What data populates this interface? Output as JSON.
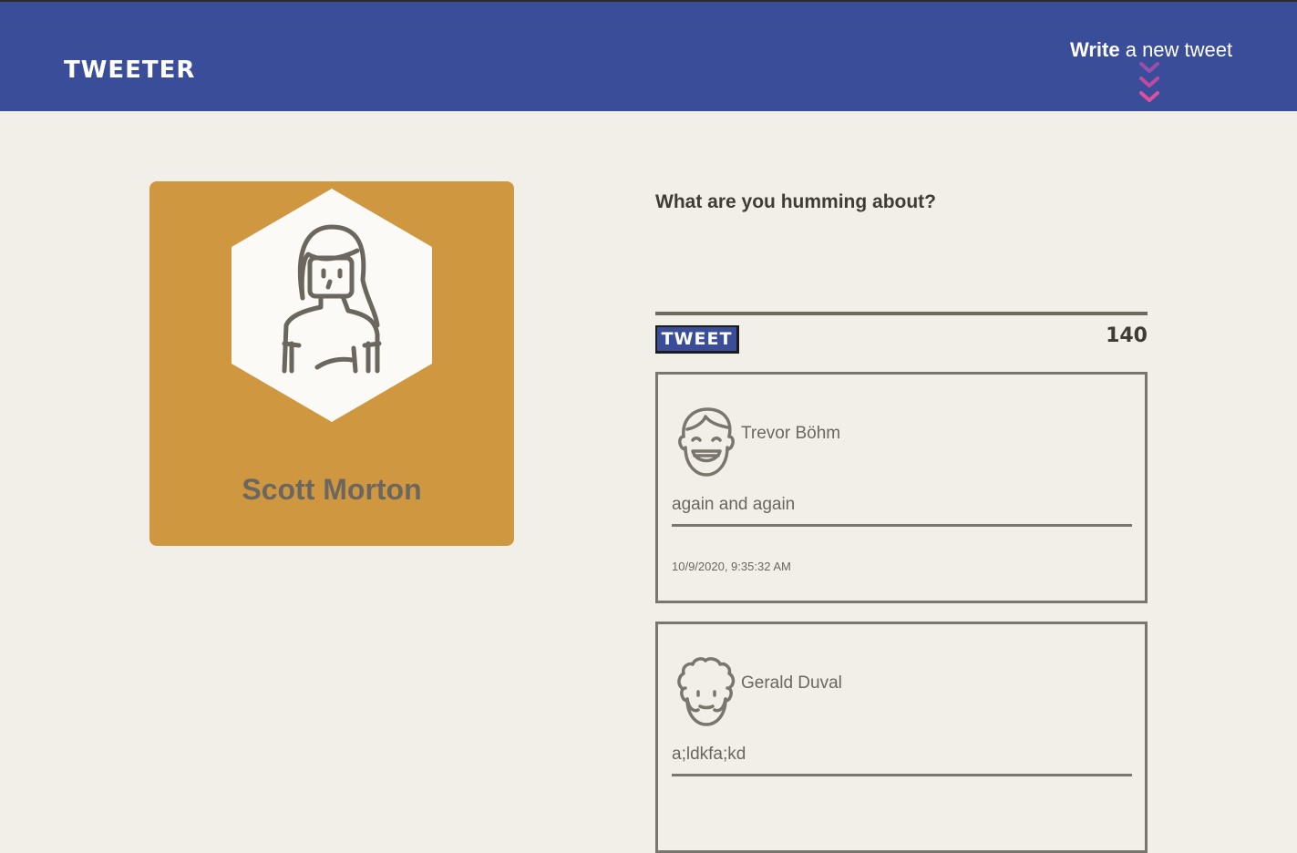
{
  "nav": {
    "logo": "TWEETER",
    "compose_bold": "Write",
    "compose_rest": " a new tweet",
    "chevron_color": "#d04a9a"
  },
  "profile": {
    "name": "Scott Morton",
    "card_color": "#cf9740",
    "avatar_icon": "woman-avatar-icon"
  },
  "composer": {
    "label": "What are you humming about?",
    "value": "",
    "button_label": "TWEET",
    "counter": "140"
  },
  "tweets": [
    {
      "author": "Trevor Böhm",
      "avatar_icon": "laughing-man-avatar-icon",
      "content": "again and again",
      "timestamp": "10/9/2020, 9:35:32 AM"
    },
    {
      "author": "Gerald Duval",
      "avatar_icon": "curly-hair-man-avatar-icon",
      "content": "a;ldkfa;kd"
    }
  ],
  "colors": {
    "nav_bg": "#394d98",
    "page_bg": "#f2efe9",
    "text": "#545149",
    "border": "#7a766e"
  }
}
